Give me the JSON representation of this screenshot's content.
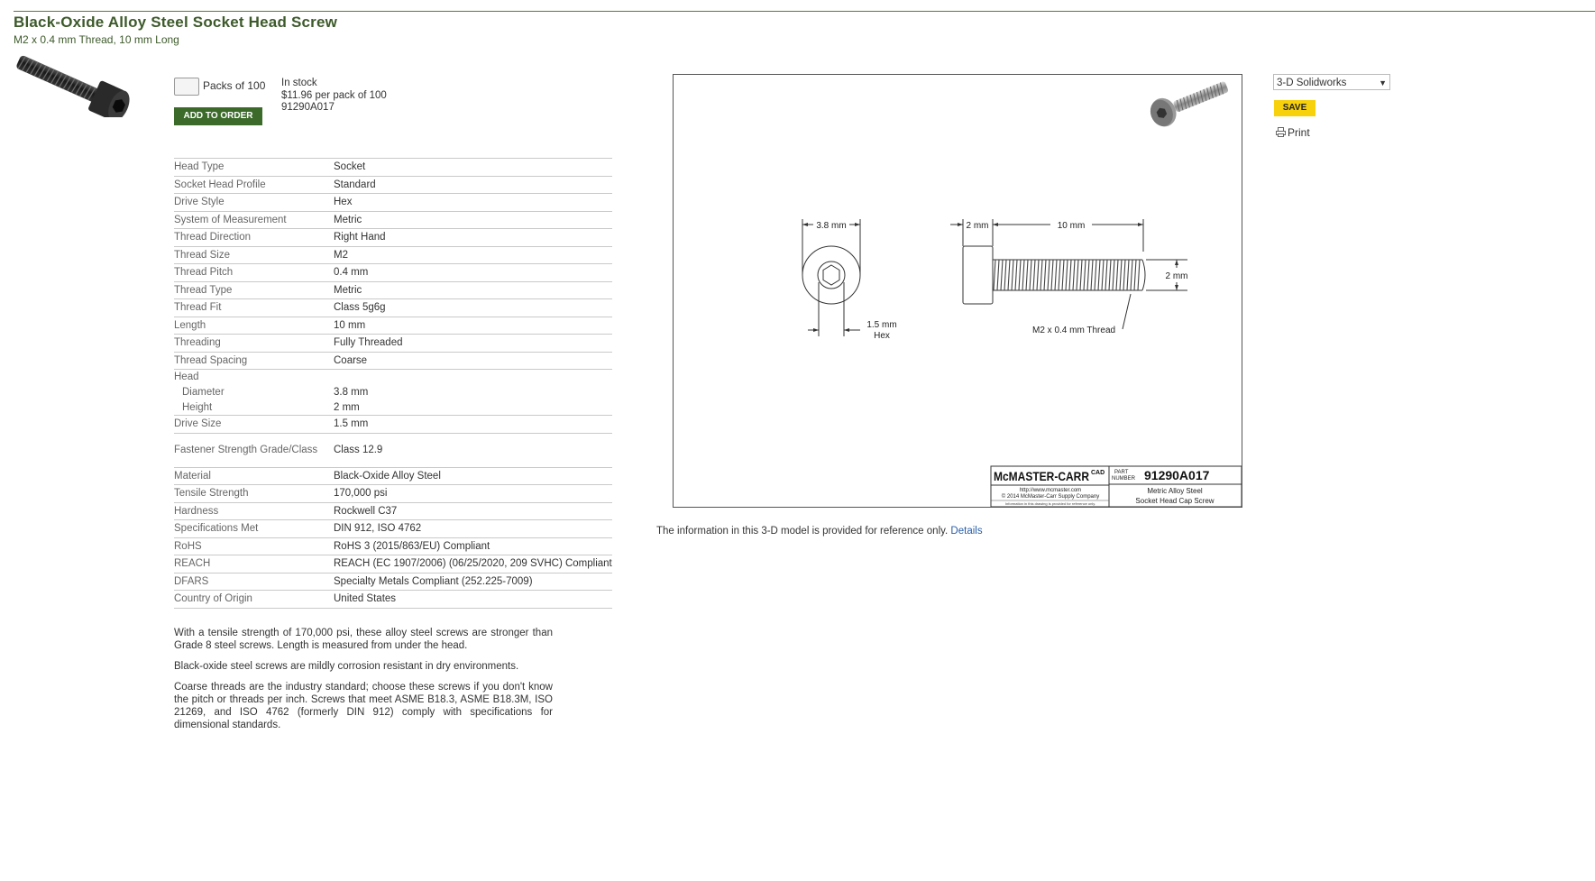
{
  "product": {
    "title": "Black-Oxide Alloy Steel Socket Head Screw",
    "subtitle": "M2 x 0.4 mm Thread, 10 mm Long"
  },
  "order": {
    "quantity_value": "",
    "pack_label": "Packs of 100",
    "add_button": "ADD TO ORDER",
    "stock_status": "In stock",
    "price": "$11.96 per pack of 100",
    "part_number": "91290A017"
  },
  "specs": [
    {
      "key": "Head Type",
      "value": "Socket"
    },
    {
      "key": "Socket Head Profile",
      "value": "Standard"
    },
    {
      "key": "Drive Style",
      "value": "Hex"
    },
    {
      "key": "System of Measurement",
      "value": "Metric"
    },
    {
      "key": "Thread Direction",
      "value": "Right Hand"
    },
    {
      "key": "Thread Size",
      "value": "M2"
    },
    {
      "key": "Thread Pitch",
      "value": "0.4 mm"
    },
    {
      "key": "Thread Type",
      "value": "Metric"
    },
    {
      "key": "Thread Fit",
      "value": "Class 5g6g"
    },
    {
      "key": "Length",
      "value": "10 mm"
    },
    {
      "key": "Threading",
      "value": "Fully Threaded"
    },
    {
      "key": "Thread Spacing",
      "value": "Coarse"
    },
    {
      "key": "Head",
      "value": ""
    },
    {
      "key": "Diameter",
      "value": "3.8 mm"
    },
    {
      "key": "Height",
      "value": "2 mm"
    },
    {
      "key": "Drive Size",
      "value": "1.5 mm"
    },
    {
      "key": "Fastener Strength Grade/Class",
      "value": "Class 12.9"
    },
    {
      "key": "Material",
      "value": "Black-Oxide Alloy Steel"
    },
    {
      "key": "Tensile Strength",
      "value": "170,000 psi"
    },
    {
      "key": "Hardness",
      "value": "Rockwell C37"
    },
    {
      "key": "Specifications Met",
      "value": "DIN 912, ISO 4762"
    },
    {
      "key": "RoHS",
      "value": "RoHS 3 (2015/863/EU) Compliant"
    },
    {
      "key": "REACH",
      "value": "REACH (EC 1907/2006) (06/25/2020, 209 SVHC) Compliant"
    },
    {
      "key": "DFARS",
      "value": "Specialty Metals Compliant (252.225-7009)"
    },
    {
      "key": "Country of Origin",
      "value": "United States"
    }
  ],
  "description": [
    "With a tensile strength of 170,000 psi, these alloy steel screws are stronger than Grade 8 steel screws. Length is measured from under the head.",
    "Black-oxide steel screws are mildly corrosion resistant in dry environments.",
    "Coarse threads are the industry standard; choose these screws if you don't know the pitch or threads per inch. Screws that meet ASME B18.3, ASME B18.3M, ISO 21269, and ISO 4762 (formerly DIN 912) comply with specifications for dimensional standards."
  ],
  "drawing": {
    "dim_head_diameter": "3.8 mm",
    "dim_hex": "1.5 mm",
    "dim_hex_label": "Hex",
    "dim_head_height": "2 mm",
    "dim_length": "10 mm",
    "dim_thread_diameter": "2 mm",
    "thread_callout": "M2 x 0.4 mm Thread",
    "brand": "McMASTER-CARR",
    "cad_mark": "CAD",
    "part_label_1": "PART",
    "part_label_2": "NUMBER",
    "part_number": "91290A017",
    "website": "http://www.mcmaster.com",
    "copyright": "© 2014 McMaster-Carr Supply Company",
    "fine_print": "Information in this drawing is provided for reference only.",
    "desc_line1": "Metric Alloy Steel",
    "desc_line2": "Socket Head Cap Screw"
  },
  "disclaimer": {
    "text": "The information in this 3-D model is provided for reference only.",
    "link": "Details"
  },
  "cad": {
    "format_selected": "3-D Solidworks",
    "save_label": "SAVE",
    "print_label": "Print"
  },
  "icons": [
    "screw-thumbnail",
    "screw-3d-icon",
    "printer-icon",
    "dropdown-arrow-icon"
  ]
}
